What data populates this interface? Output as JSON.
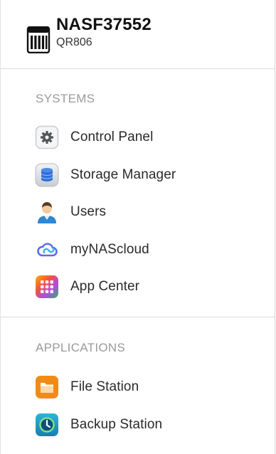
{
  "device": {
    "name": "NASF37552",
    "model": "QR806",
    "icon": "nas-device-icon"
  },
  "sections": {
    "systems": {
      "title": "SYSTEMS",
      "items": [
        {
          "label": "Control Panel",
          "icon": "control-panel-gear-icon"
        },
        {
          "label": "Storage Manager",
          "icon": "storage-manager-database-icon"
        },
        {
          "label": "Users",
          "icon": "users-person-icon"
        },
        {
          "label": "myNAScloud",
          "icon": "mynascloud-cloud-icon"
        },
        {
          "label": "App Center",
          "icon": "app-center-grid-icon"
        }
      ]
    },
    "applications": {
      "title": "APPLICATIONS",
      "items": [
        {
          "label": "File Station",
          "icon": "file-station-folder-icon"
        },
        {
          "label": "Backup Station",
          "icon": "backup-station-clock-icon"
        }
      ]
    }
  },
  "colors": {
    "section_title": "#9a9a9a",
    "divider": "#dcdcdc",
    "storage_blue": "#2f6fd6",
    "cloud_purple": "#5b6cf0",
    "file_orange": "#f08c16",
    "backup_teal": "#1aa0c0"
  }
}
